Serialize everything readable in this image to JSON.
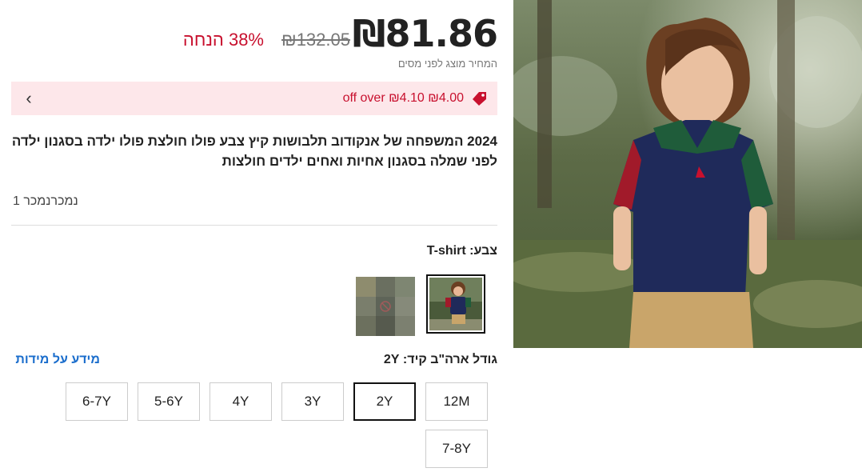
{
  "price": {
    "current": "₪81.86",
    "original": "₪132.05",
    "discount": "38% הנחה",
    "tax_note": "המחיר מוצג לפני מסים"
  },
  "coupon": {
    "text": "off over ₪4.10 ₪4.00",
    "icon": "tag-icon",
    "chevron": "chevron-left-icon"
  },
  "product": {
    "title": "2024 המשפחה של אנקודוב תלבושות קיץ צבע פולו חולצת פולו ילדה בסגנון ילדה לפני שמלה בסגנון אחיות ואחים ילדים חולצות",
    "sold": "נמכרנמכר 1"
  },
  "color": {
    "label": "צבע:",
    "value": "T-shirt"
  },
  "size": {
    "label": "גודל ארה\"ב קיד:",
    "value": "2Y",
    "guide": "מידע על מידות",
    "options": [
      "12M",
      "2Y",
      "3Y",
      "4Y",
      "5-6Y",
      "6-7Y",
      "7-8Y"
    ],
    "selected": "2Y"
  },
  "colors": {
    "accent_red": "#c8102e",
    "coupon_bg": "#fde7ea",
    "link_blue": "#1a6dcc"
  }
}
